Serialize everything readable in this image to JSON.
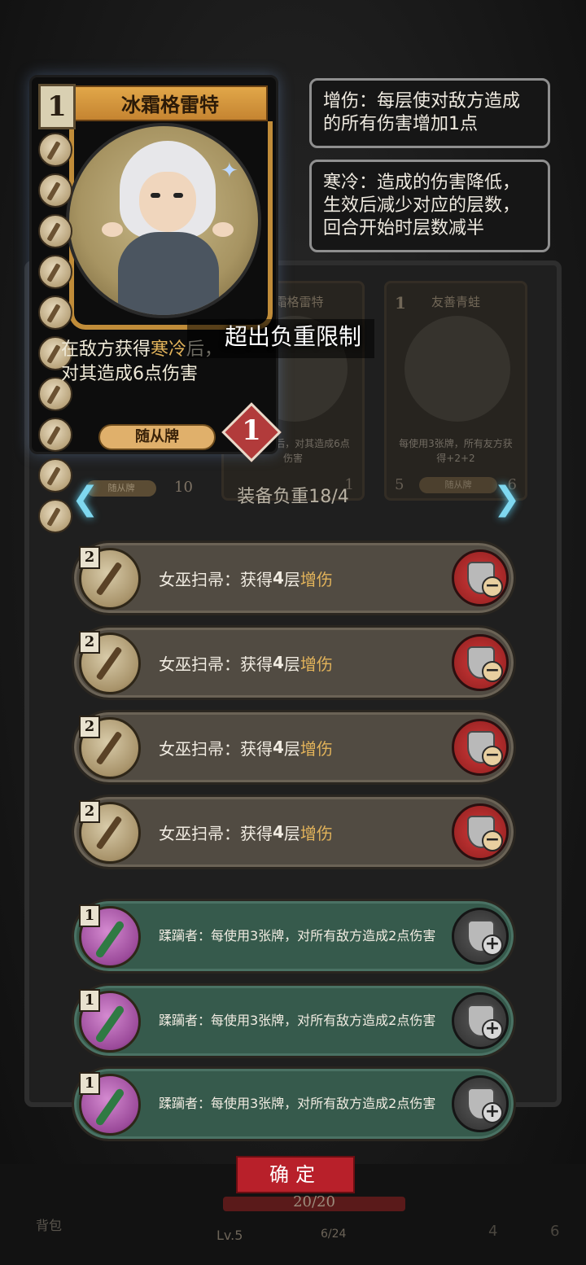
{
  "big_card": {
    "level": "1",
    "title": "冰霜格雷特",
    "desc_prefix": "在敌方获得",
    "desc_keyword": "寒冷",
    "desc_after": "后，",
    "desc_line2": "对其造成6点伤害",
    "type_label": "随从牌",
    "cost": "1"
  },
  "tooltips": [
    {
      "keyword": "增伤：",
      "text": "每层使对敌方造成的所有伤害增加1点"
    },
    {
      "keyword": "寒冷：",
      "text": "造成的伤害降低，生效后减少对应的层数，回合开始时层数减半"
    }
  ],
  "overload_message": "超出负重限制",
  "load_label": "装备负重18/4",
  "arrows": {
    "left": "❮",
    "right": "❯"
  },
  "bg_cards": [
    {
      "title": "冰霜格雷特",
      "level": "",
      "desc": "获得寒冷后，对其造成6点伤害",
      "type": "",
      "cost_left": "",
      "cost_right": "1"
    },
    {
      "title": "友善青蛙",
      "level": "1",
      "desc": "每使用3张牌，所有友方获得+2+2",
      "type": "随从牌",
      "cost_left": "5",
      "cost_right": "6"
    }
  ],
  "bg_left_card": {
    "type": "随从牌",
    "cost": "10"
  },
  "equipment": [
    {
      "level": "2",
      "name": "女巫扫帚",
      "sep": "：",
      "text_a": "获得",
      "num": "4",
      "text_b": "层",
      "keyword": "增伤",
      "action": "remove"
    },
    {
      "level": "2",
      "name": "女巫扫帚",
      "sep": "：",
      "text_a": "获得",
      "num": "4",
      "text_b": "层",
      "keyword": "增伤",
      "action": "remove"
    },
    {
      "level": "2",
      "name": "女巫扫帚",
      "sep": "：",
      "text_a": "获得",
      "num": "4",
      "text_b": "层",
      "keyword": "增伤",
      "action": "remove"
    },
    {
      "level": "2",
      "name": "女巫扫帚",
      "sep": "：",
      "text_a": "获得",
      "num": "4",
      "text_b": "层",
      "keyword": "增伤",
      "action": "remove"
    },
    {
      "level": "1",
      "text": "蹂躏者：每使用3张牌，对所有敌方造成2点伤害",
      "action": "add"
    },
    {
      "level": "1",
      "text": "蹂躏者：每使用3张牌，对所有敌方造成2点伤害",
      "action": "add"
    },
    {
      "level": "1",
      "text": "蹂躏者：每使用3张牌，对所有敌方造成2点伤害",
      "action": "add"
    }
  ],
  "confirm_label": "确定",
  "hp_text": "20/20",
  "level_text": "Lv.5",
  "xp_text": "6/24",
  "bag_label": "背包",
  "corner_left": "4",
  "corner_right": "6",
  "colors": {
    "keyword": "#e2b35a",
    "confirm": "#b8202a",
    "row_gold": "#514b42",
    "row_green": "#365a4c",
    "minus": "#d23a3a"
  }
}
